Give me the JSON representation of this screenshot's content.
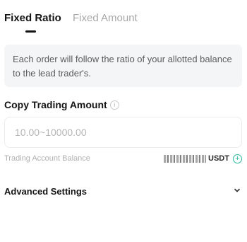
{
  "tabs": [
    {
      "label": "Fixed Ratio",
      "active": true
    },
    {
      "label": "Fixed Amount",
      "active": false
    }
  ],
  "info": {
    "text": "Each order will follow the ratio of your allotted balance to the lead trader's."
  },
  "copy_trading": {
    "title": "Copy Trading Amount",
    "help_icon": "help-circle-icon",
    "input": {
      "value": "",
      "placeholder": "10.00~10000.00"
    }
  },
  "balance": {
    "label": "Trading Account Balance",
    "value_masked": true,
    "unit": "USDT",
    "add_icon": "plus-circle-icon"
  },
  "advanced": {
    "label": "Advanced Settings",
    "icon": "chevron-down-icon"
  },
  "colors": {
    "accent": "#2bb8a0",
    "text_primary": "#141414",
    "text_muted": "#b0b0b0",
    "info_bg": "#f4f5f7"
  }
}
